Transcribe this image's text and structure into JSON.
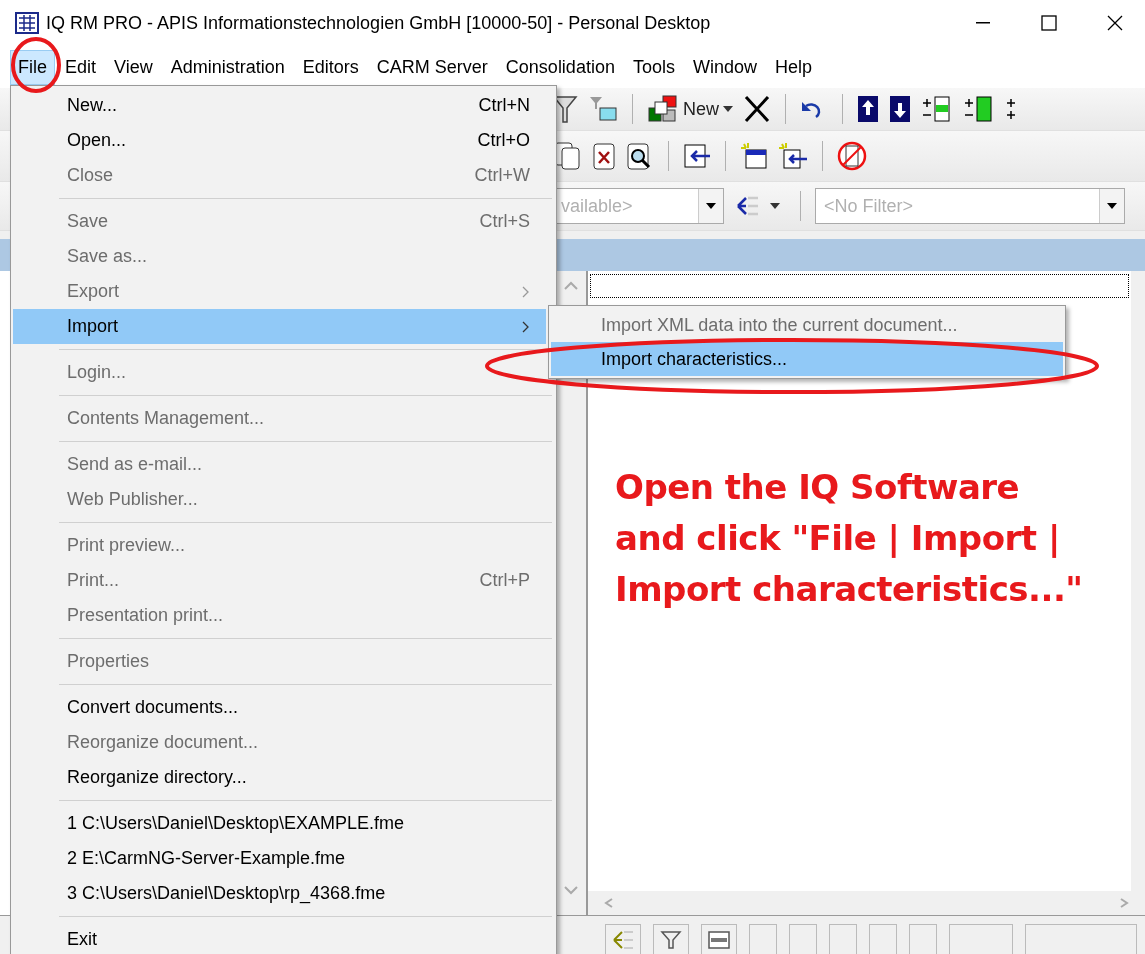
{
  "window": {
    "title": "IQ RM PRO - APIS Informationstechnologien GmbH [10000-50] - Personal Desktop"
  },
  "menubar": [
    {
      "label": "File",
      "selected": true
    },
    {
      "label": "Edit",
      "selected": false
    },
    {
      "label": "View",
      "selected": false
    },
    {
      "label": "Administration",
      "selected": false
    },
    {
      "label": "Editors",
      "selected": false
    },
    {
      "label": "CARM Server",
      "selected": false
    },
    {
      "label": "Consolidation",
      "selected": false
    },
    {
      "label": "Tools",
      "selected": false
    },
    {
      "label": "Window",
      "selected": false
    },
    {
      "label": "Help",
      "selected": false
    }
  ],
  "toolbar": {
    "new_label": "New",
    "combo_1": "vailable>",
    "combo_2": "<No Filter>"
  },
  "file_menu": [
    {
      "kind": "item",
      "label": "New...",
      "shortcut": "Ctrl+N",
      "disabled": false,
      "selected": false
    },
    {
      "kind": "item",
      "label": "Open...",
      "shortcut": "Ctrl+O",
      "disabled": false,
      "selected": false
    },
    {
      "kind": "item",
      "label": "Close",
      "shortcut": "Ctrl+W",
      "disabled": true,
      "selected": false
    },
    {
      "kind": "separator"
    },
    {
      "kind": "item",
      "label": "Save",
      "shortcut": "Ctrl+S",
      "disabled": true,
      "selected": false
    },
    {
      "kind": "item",
      "label": "Save as...",
      "disabled": true,
      "selected": false
    },
    {
      "kind": "submenu",
      "label": "Export",
      "disabled": true,
      "selected": false
    },
    {
      "kind": "submenu",
      "label": "Import",
      "disabled": false,
      "selected": true
    },
    {
      "kind": "separator"
    },
    {
      "kind": "item",
      "label": "Login...",
      "disabled": true,
      "selected": false
    },
    {
      "kind": "separator"
    },
    {
      "kind": "item",
      "label": "Contents Management...",
      "disabled": true,
      "selected": false
    },
    {
      "kind": "separator"
    },
    {
      "kind": "item",
      "label": "Send as e-mail...",
      "disabled": true,
      "selected": false
    },
    {
      "kind": "item",
      "label": "Web Publisher...",
      "disabled": true,
      "selected": false
    },
    {
      "kind": "separator"
    },
    {
      "kind": "item",
      "label": "Print preview...",
      "disabled": true,
      "selected": false
    },
    {
      "kind": "item",
      "label": "Print...",
      "shortcut": "Ctrl+P",
      "disabled": true,
      "selected": false
    },
    {
      "kind": "item",
      "label": "Presentation print...",
      "disabled": true,
      "selected": false
    },
    {
      "kind": "separator"
    },
    {
      "kind": "item",
      "label": "Properties",
      "disabled": true,
      "selected": false
    },
    {
      "kind": "separator"
    },
    {
      "kind": "item",
      "label": "Convert documents...",
      "disabled": false,
      "selected": false
    },
    {
      "kind": "item",
      "label": "Reorganize document...",
      "disabled": true,
      "selected": false
    },
    {
      "kind": "item",
      "label": "Reorganize directory...",
      "disabled": false,
      "selected": false
    },
    {
      "kind": "separator"
    },
    {
      "kind": "item",
      "label": "1 C:\\Users\\Daniel\\Desktop\\EXAMPLE.fme",
      "disabled": false,
      "selected": false
    },
    {
      "kind": "item",
      "label": "2 E:\\CarmNG-Server-Example.fme",
      "disabled": false,
      "selected": false
    },
    {
      "kind": "item",
      "label": "3 C:\\Users\\Daniel\\Desktop\\rp_4368.fme",
      "disabled": false,
      "selected": false
    },
    {
      "kind": "separator"
    },
    {
      "kind": "item",
      "label": "Exit",
      "disabled": false,
      "selected": false
    }
  ],
  "import_submenu": [
    {
      "label": "Import XML data into the current document...",
      "disabled": true,
      "selected": false
    },
    {
      "label": "Import characteristics...",
      "disabled": false,
      "selected": true
    }
  ],
  "annotation": {
    "text": "Open the IQ Software and click \"File | Import | Import characteristics...\""
  }
}
